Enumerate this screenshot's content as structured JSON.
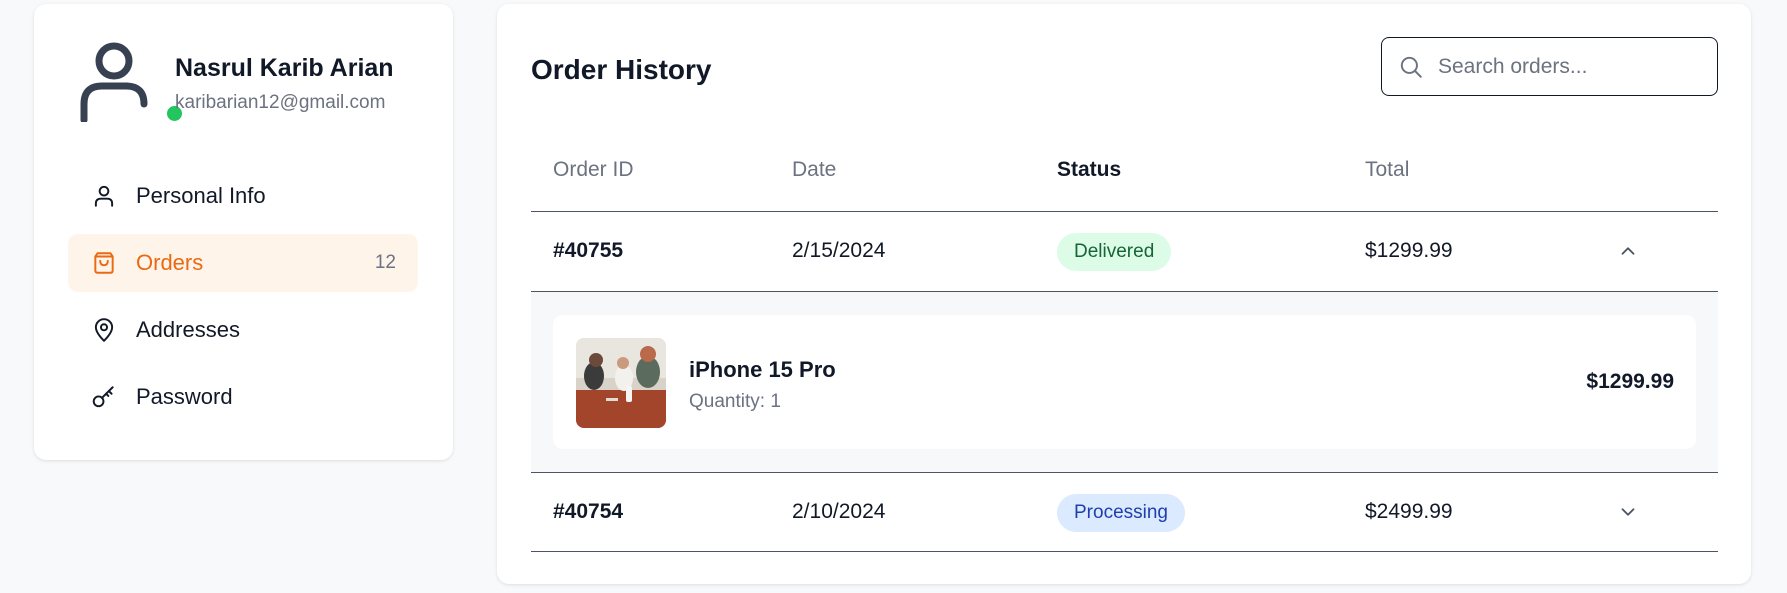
{
  "profile": {
    "name": "Nasrul Karib Arian",
    "email": "karibarian12@gmail.com",
    "online": true,
    "online_color": "#22c55e"
  },
  "nav": [
    {
      "label": "Personal Info",
      "icon": "user-icon",
      "active": false
    },
    {
      "label": "Orders",
      "icon": "shopping-bag-icon",
      "active": true,
      "count": "12"
    },
    {
      "label": "Addresses",
      "icon": "map-pin-icon",
      "active": false
    },
    {
      "label": "Password",
      "icon": "key-icon",
      "active": false
    }
  ],
  "accent_color": "#ea6a12",
  "main": {
    "title": "Order History",
    "search": {
      "placeholder": "Search orders...",
      "value": ""
    },
    "columns": [
      "Order ID",
      "Date",
      "Status",
      "Total"
    ],
    "orders": [
      {
        "id": "#40755",
        "date": "2/15/2024",
        "status": "Delivered",
        "total": "$1299.99",
        "expanded": true,
        "items": [
          {
            "name": "iPhone 15 Pro",
            "quantity": "Quantity: 1",
            "price": "$1299.99"
          }
        ]
      },
      {
        "id": "#40754",
        "date": "2/10/2024",
        "status": "Processing",
        "total": "$2499.99",
        "expanded": false
      }
    ]
  }
}
